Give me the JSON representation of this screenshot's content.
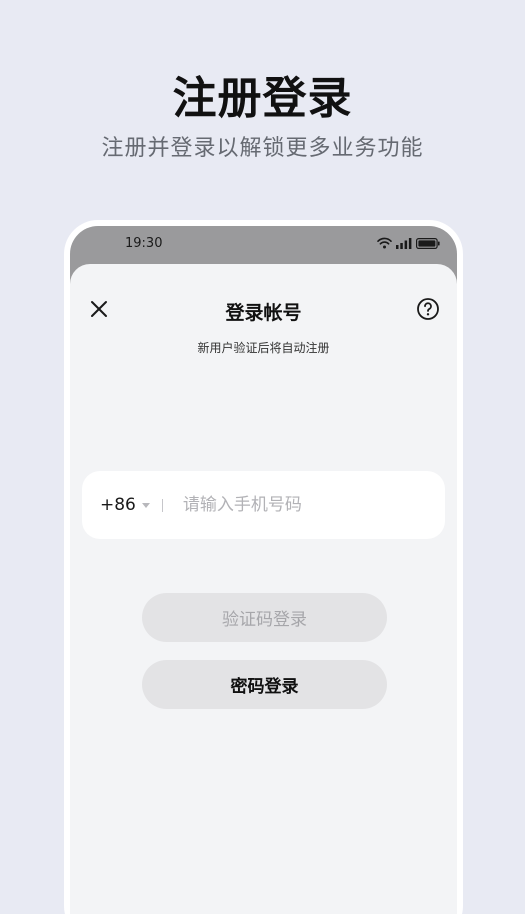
{
  "hero": {
    "title": "注册登录",
    "subtitle": "注册并登录以解锁更多业务功能"
  },
  "status_bar": {
    "time": "19:30",
    "icons": [
      "wifi-icon",
      "signal-icon",
      "battery-icon"
    ]
  },
  "sheet": {
    "title": "登录帐号",
    "subtitle": "新用户验证后将自动注册",
    "close_icon": "close-icon",
    "help_icon": "help-icon"
  },
  "phone_field": {
    "country_code": "+86",
    "value": "",
    "placeholder": "请输入手机号码"
  },
  "buttons": {
    "verify_code_login": "验证码登录",
    "password_login": "密码登录"
  },
  "colors": {
    "background": "#e8eaf3",
    "sheet_background": "#f3f4f6",
    "button_background": "#e3e3e5",
    "disabled_text": "#a6a6aa"
  }
}
